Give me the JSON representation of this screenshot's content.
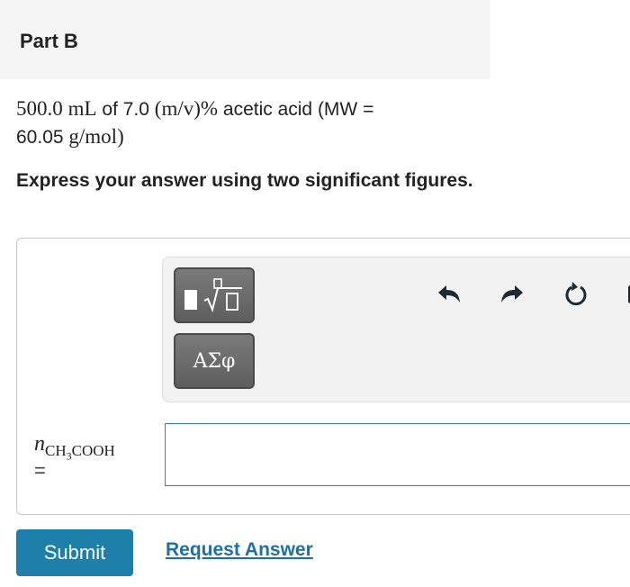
{
  "part": {
    "title": "Part B"
  },
  "question": {
    "amount": "500.0",
    "unit_ml": "mL",
    "text_of": "of 7.0",
    "unit_mv": "(m/v)%",
    "text_acid": "acetic acid (MW =",
    "mw_value": "60.05",
    "unit_mw": "g/mol)"
  },
  "instructions": "Express your answer using two significant figures.",
  "toolbar": {
    "greek_label": "ΑΣφ",
    "icons": [
      "templates-icon",
      "undo-icon",
      "redo-icon",
      "reset-icon",
      "keyboard-icon"
    ]
  },
  "answer": {
    "variable": "n",
    "subscript_a": "CH",
    "subscript_n": "3",
    "subscript_b": "COOH",
    "equals": "=",
    "value": ""
  },
  "actions": {
    "submit_label": "Submit",
    "request_label": "Request Answer"
  },
  "colors": {
    "submit_bg": "#1d7faa",
    "link": "#1d6fa8",
    "input_border": "#2a8a9e"
  }
}
